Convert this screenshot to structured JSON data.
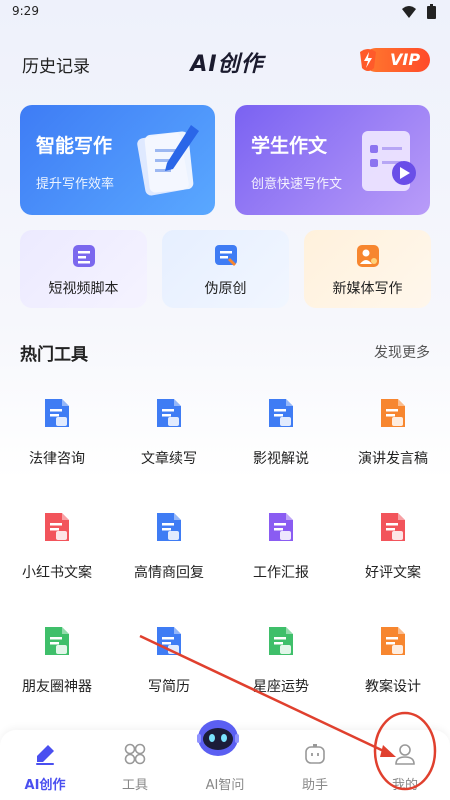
{
  "status": {
    "time": "9:29"
  },
  "header": {
    "history": "历史记录",
    "title": "AI创作",
    "vip": "VIP"
  },
  "feature_cards": [
    {
      "title": "智能写作",
      "subtitle": "提升写作效率"
    },
    {
      "title": "学生作文",
      "subtitle": "创意快速写作文"
    }
  ],
  "quick_cards": [
    {
      "label": "短视频脚本",
      "icon": "video-script-icon"
    },
    {
      "label": "伪原创",
      "icon": "rewrite-icon"
    },
    {
      "label": "新媒体写作",
      "icon": "new-media-icon"
    }
  ],
  "hot_tools": {
    "title": "热门工具",
    "more": "发现更多",
    "items": [
      {
        "label": "法律咨询",
        "icon": "law-doc-icon",
        "color": "#3f7cf4"
      },
      {
        "label": "文章续写",
        "icon": "article-continue-icon",
        "color": "#3f7cf4"
      },
      {
        "label": "影视解说",
        "icon": "film-commentary-icon",
        "color": "#3f7cf4"
      },
      {
        "label": "演讲发言稿",
        "icon": "speech-doc-icon",
        "color": "#f7862f"
      },
      {
        "label": "小红书文案",
        "icon": "xiaohongshu-icon",
        "color": "#f2545b"
      },
      {
        "label": "高情商回复",
        "icon": "eq-reply-icon",
        "color": "#3f7cf4"
      },
      {
        "label": "工作汇报",
        "icon": "work-report-icon",
        "color": "#8a5cf2"
      },
      {
        "label": "好评文案",
        "icon": "good-review-icon",
        "color": "#f2545b"
      },
      {
        "label": "朋友圈神器",
        "icon": "moments-icon",
        "color": "#3fbf6a"
      },
      {
        "label": "写简历",
        "icon": "resume-icon",
        "color": "#3f7cf4"
      },
      {
        "label": "星座运势",
        "icon": "horoscope-icon",
        "color": "#3fbf6a"
      },
      {
        "label": "教案设计",
        "icon": "lesson-plan-icon",
        "color": "#f7862f"
      }
    ]
  },
  "tabbar": {
    "items": [
      {
        "label": "AI创作",
        "icon": "pen-icon",
        "active": true
      },
      {
        "label": "工具",
        "icon": "grid-icon",
        "active": false
      },
      {
        "label": "AI智问",
        "icon": "robot-icon",
        "active": false
      },
      {
        "label": "助手",
        "icon": "assistant-icon",
        "active": false
      },
      {
        "label": "我的",
        "icon": "user-icon",
        "active": false
      }
    ]
  },
  "colors": {
    "accent": "#4a4ff0",
    "annotation": "#e0402e"
  }
}
